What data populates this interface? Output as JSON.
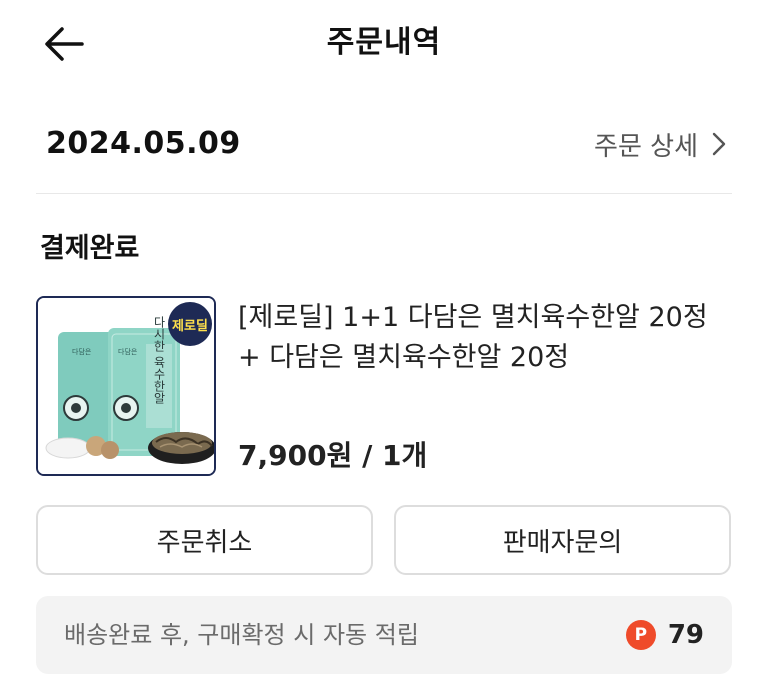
{
  "header": {
    "title": "주문내역",
    "back_icon": "arrow-left-icon"
  },
  "order": {
    "date": "2024.05.09",
    "detail_label": "주문 상세",
    "detail_icon": "chevron-right-icon",
    "status": "결제완료"
  },
  "product": {
    "name": "[제로딜] 1+1 다담은 멸치육수한알 20정 + 다담은 멸치육수한알 20정",
    "price": "7,900원 / 1개",
    "image": {
      "badge_text": "제로딜",
      "pack_title": "다시한 육수한알",
      "brand": "다담은"
    }
  },
  "actions": {
    "cancel_label": "주문취소",
    "inquiry_label": "판매자문의"
  },
  "points": {
    "text": "배송완료 후, 구매확정 시 자동 적립",
    "badge": "P",
    "value": "79",
    "badge_color": "#ef4b2a"
  }
}
